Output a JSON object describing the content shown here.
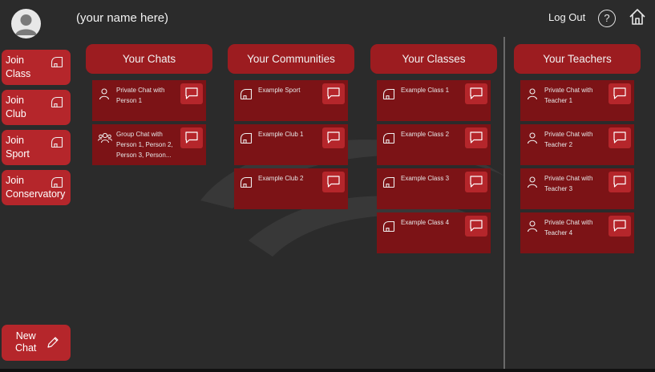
{
  "header": {
    "user_name": "(your name here)",
    "logout_label": "Log Out",
    "help_symbol": "?"
  },
  "sidebar": {
    "items": [
      {
        "label": "Join\nClass",
        "icon": "hall-icon"
      },
      {
        "label": "Join\nClub",
        "icon": "hall-icon"
      },
      {
        "label": "Join\nSport",
        "icon": "hall-icon"
      },
      {
        "label": "Join\nConservatory",
        "icon": "hall-icon"
      }
    ],
    "new_chat_label": "New\nChat"
  },
  "columns": [
    {
      "title": "Your Chats",
      "cards": [
        {
          "text": "Private Chat with Person 1",
          "icon": "person-icon"
        },
        {
          "text": "Group Chat with Person 1, Person 2, Person 3, Person...",
          "icon": "group-icon"
        }
      ]
    },
    {
      "title": "Your Communities",
      "cards": [
        {
          "text": "Example Sport",
          "icon": "hall-icon"
        },
        {
          "text": "Example Club 1",
          "icon": "hall-icon"
        },
        {
          "text": "Example Club 2",
          "icon": "hall-icon"
        }
      ]
    },
    {
      "title": "Your Classes",
      "cards": [
        {
          "text": "Example Class 1",
          "icon": "hall-icon"
        },
        {
          "text": "Example Class 2",
          "icon": "hall-icon"
        },
        {
          "text": "Example Class 3",
          "icon": "hall-icon"
        },
        {
          "text": "Example Class 4",
          "icon": "hall-icon"
        }
      ]
    },
    {
      "title": "Your Teachers",
      "cards": [
        {
          "text": "Private Chat with Teacher 1",
          "icon": "person-icon"
        },
        {
          "text": "Private Chat with Teacher 2",
          "icon": "person-icon"
        },
        {
          "text": "Private Chat with Teacher 3",
          "icon": "person-icon"
        },
        {
          "text": "Private Chat with Teacher 4",
          "icon": "person-icon"
        }
      ]
    }
  ],
  "colors": {
    "background": "#2b2b2b",
    "button_red": "#b5262b",
    "header_red": "#9c1c20",
    "card_red": "#7c1316"
  }
}
